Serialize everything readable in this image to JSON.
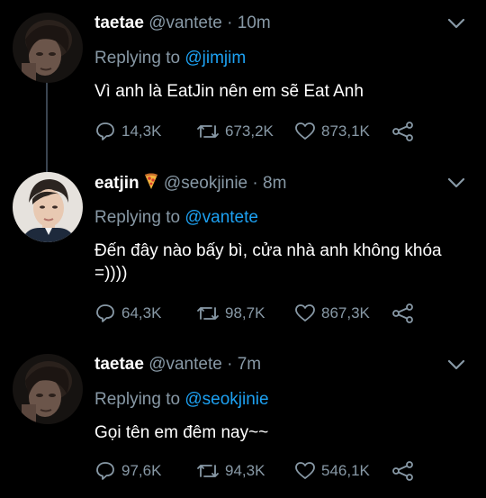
{
  "tweets": [
    {
      "display_name": "taetae",
      "handle": "@vantete",
      "time": "10m",
      "replying_prefix": "Replying to",
      "replying_to": "@jimjim",
      "text": "Vì anh là EatJin nên em sẽ Eat Anh",
      "replies": "14,3K",
      "retweets": "673,2K",
      "likes": "873,1K",
      "avatar_icon": "profile-photo-avatar"
    },
    {
      "display_name": "eatjin",
      "name_emoji": "pizza-icon",
      "handle": "@seokjinie",
      "time": "8m",
      "replying_prefix": "Replying to",
      "replying_to": "@vantete",
      "text": "Đến đây nào bấy bì, cửa nhà anh không khóa =))))",
      "replies": "64,3K",
      "retweets": "98,7K",
      "likes": "867,3K",
      "avatar_icon": "profile-photo-avatar"
    },
    {
      "display_name": "taetae",
      "handle": "@vantete",
      "time": "7m",
      "replying_prefix": "Replying to",
      "replying_to": "@seokjinie",
      "text": "Gọi tên em đêm nay~~",
      "replies": "97,6K",
      "retweets": "94,3K",
      "likes": "546,1K",
      "avatar_icon": "profile-photo-avatar"
    }
  ],
  "colors": {
    "background": "#000000",
    "text": "#ffffff",
    "muted": "#8899a6",
    "link": "#1da1f2",
    "thread_line": "#3a4450"
  }
}
